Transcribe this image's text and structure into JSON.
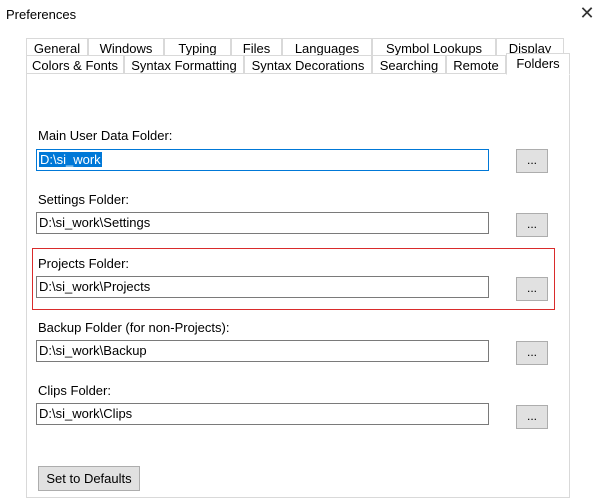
{
  "window": {
    "title": "Preferences",
    "close_glyph": "✕"
  },
  "tabs_row1": [
    "General",
    "Windows",
    "Typing",
    "Files",
    "Languages",
    "Symbol Lookups",
    "Display"
  ],
  "tabs_row2": [
    "Colors & Fonts",
    "Syntax Formatting",
    "Syntax Decorations",
    "Searching",
    "Remote",
    "Folders"
  ],
  "selected_tab": "Folders",
  "folders": [
    {
      "label": "Main User Data Folder:",
      "value": "D:\\si_work"
    },
    {
      "label": "Settings Folder:",
      "value": "D:\\si_work\\Settings"
    },
    {
      "label": "Projects Folder:",
      "value": "D:\\si_work\\Projects"
    },
    {
      "label": "Backup Folder (for non-Projects):",
      "value": "D:\\si_work\\Backup"
    },
    {
      "label": "Clips Folder:",
      "value": "D:\\si_work\\Clips"
    }
  ],
  "browse_label": "...",
  "defaults_button": "Set to Defaults",
  "colors": {
    "highlight_border": "#d92b2b",
    "focus_border": "#0078d7",
    "selection": "#0078d7"
  },
  "icons": {
    "close": "close-icon"
  }
}
